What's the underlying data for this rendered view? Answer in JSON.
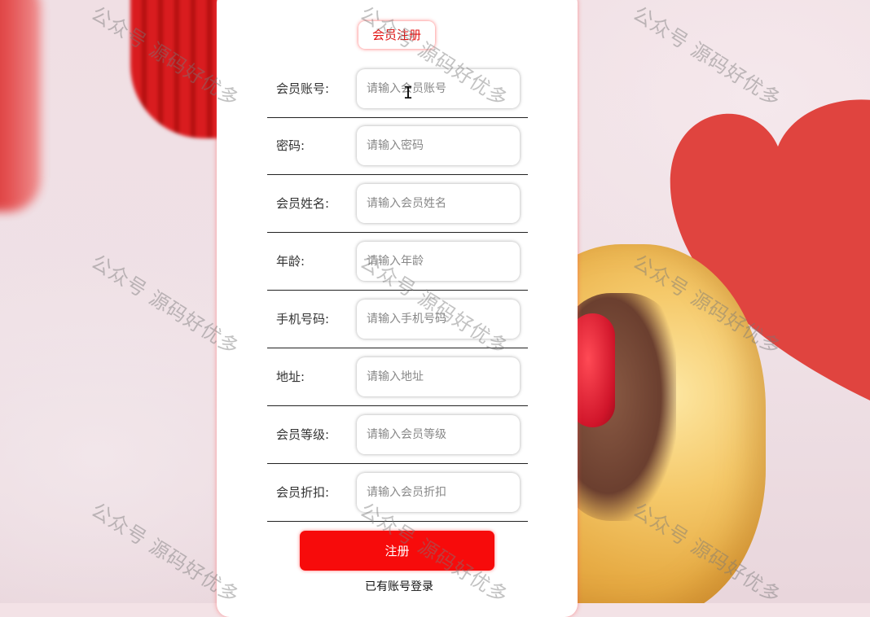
{
  "form": {
    "title": "会员注册",
    "fields": [
      {
        "label": "会员账号:",
        "placeholder": "请输入会员账号"
      },
      {
        "label": "密码:",
        "placeholder": "请输入密码"
      },
      {
        "label": "会员姓名:",
        "placeholder": "请输入会员姓名"
      },
      {
        "label": "年龄:",
        "placeholder": "请输入年龄"
      },
      {
        "label": "手机号码:",
        "placeholder": "请输入手机号码"
      },
      {
        "label": "地址:",
        "placeholder": "请输入地址"
      },
      {
        "label": "会员等级:",
        "placeholder": "请输入会员等级"
      },
      {
        "label": "会员折扣:",
        "placeholder": "请输入会员折扣"
      }
    ],
    "submit_label": "注册",
    "login_link": "已有账号登录"
  },
  "watermark": "公众号 源码好优多",
  "colors": {
    "accent": "#f70b0b",
    "title_text": "#e21212"
  }
}
